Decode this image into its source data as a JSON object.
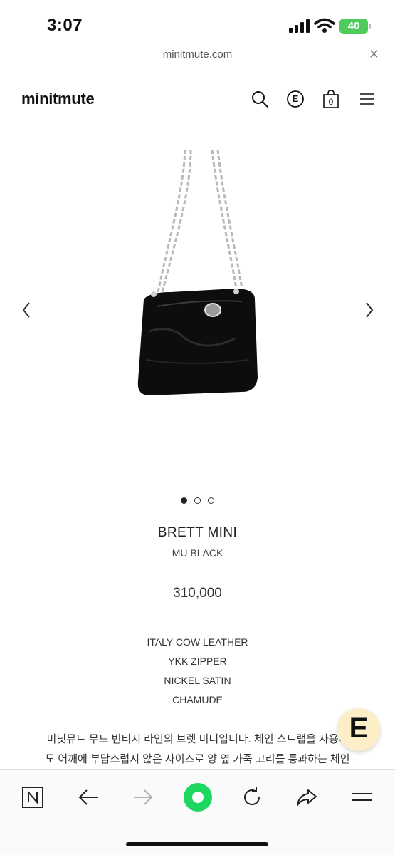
{
  "status_bar": {
    "time": "3:07",
    "battery": "40"
  },
  "browser": {
    "url": "minitmute.com"
  },
  "site": {
    "logo": "minitmute",
    "header_icons": [
      "search-icon",
      "e-money-icon",
      "cart-icon",
      "menu-icon"
    ],
    "cart_count": "0",
    "e_icon_letter": "E"
  },
  "gallery": {
    "slides": 3,
    "active_slide": 1
  },
  "product": {
    "name": "BRETT MINI",
    "color": "MU BLACK",
    "price": "310,000",
    "specs": [
      "ITALY COW LEATHER",
      "YKK ZIPPER",
      "NICKEL SATIN",
      "CHAMUDE"
    ],
    "description": [
      "미닛뮤트 무드 빈티지 라인의 브렛 미니입니다. 체인 스트랩을 사용해",
      "도 어깨에 부담스럽지 않은 사이즈로 양 옆 가죽 고리를 통과하는 체인"
    ]
  },
  "fab": {
    "label": "E"
  },
  "toolbar": {
    "items": [
      "naver-icon",
      "back-icon",
      "forward-icon",
      "home-green-icon",
      "reload-icon",
      "share-icon",
      "menu-icon"
    ]
  },
  "colors": {
    "battery": "#4fcb5c",
    "fab_bg": "#fcefc8",
    "home_green": "#1ed760",
    "text": "#222222"
  }
}
